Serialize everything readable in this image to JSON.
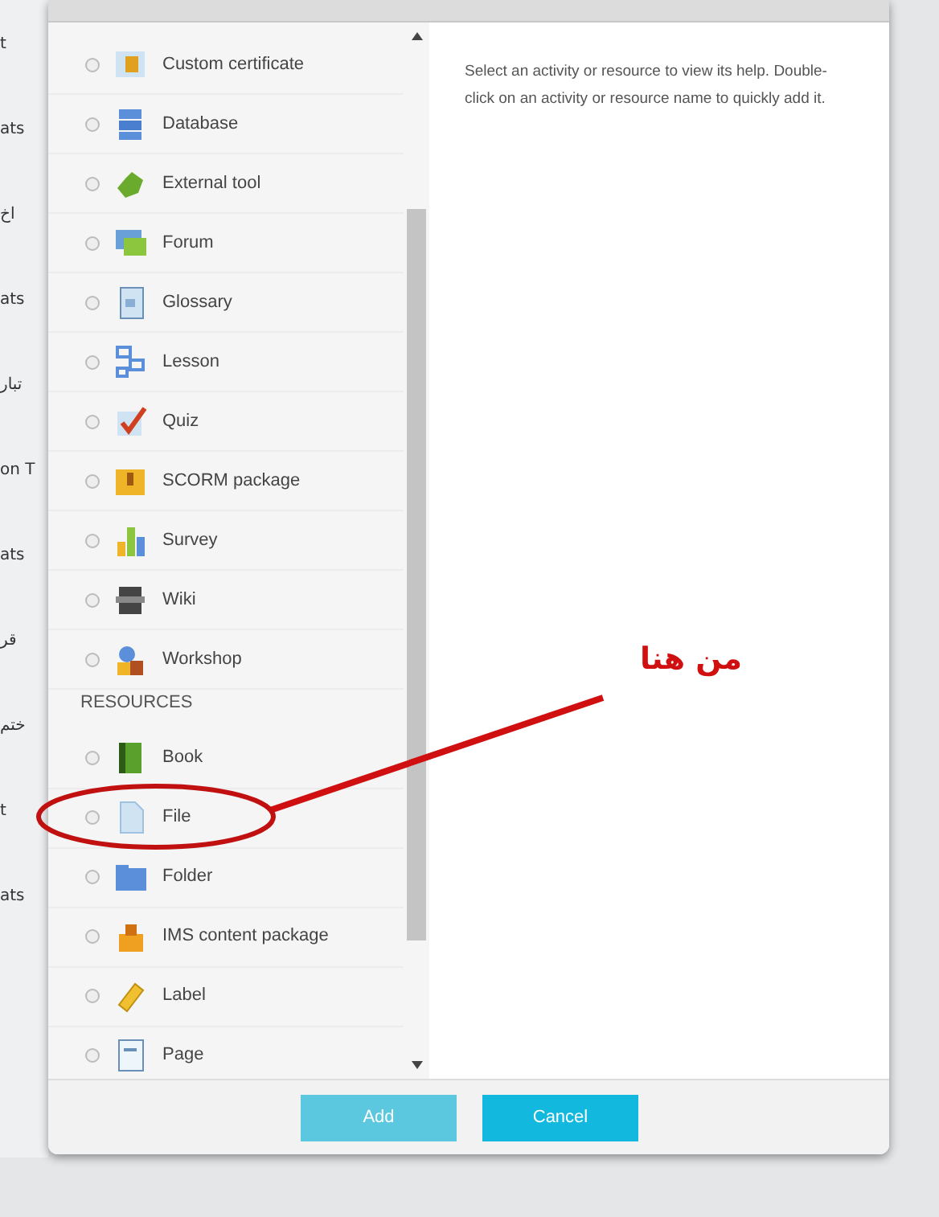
{
  "background_page": {
    "fragments": [
      "t",
      "ats",
      "اخ",
      "ats",
      "تبار",
      "on T",
      "ats",
      "قر",
      "ختم",
      "t",
      "ats"
    ]
  },
  "dialog": {
    "list": [
      {
        "kind": "item",
        "label": "Custom certificate",
        "selected": false
      },
      {
        "kind": "item",
        "label": "Database",
        "selected": false
      },
      {
        "kind": "item",
        "label": "External tool",
        "selected": false
      },
      {
        "kind": "item",
        "label": "Forum",
        "selected": false
      },
      {
        "kind": "item",
        "label": "Glossary",
        "selected": false
      },
      {
        "kind": "item",
        "label": "Lesson",
        "selected": false
      },
      {
        "kind": "item",
        "label": "Quiz",
        "selected": false
      },
      {
        "kind": "item",
        "label": "SCORM package",
        "selected": false
      },
      {
        "kind": "item",
        "label": "Survey",
        "selected": false
      },
      {
        "kind": "item",
        "label": "Wiki",
        "selected": false
      },
      {
        "kind": "item",
        "label": "Workshop",
        "selected": false
      },
      {
        "kind": "heading",
        "label": "RESOURCES"
      },
      {
        "kind": "item",
        "label": "Book",
        "selected": false
      },
      {
        "kind": "item",
        "label": "File",
        "selected": false
      },
      {
        "kind": "item",
        "label": "Folder",
        "selected": false
      },
      {
        "kind": "item",
        "label": "IMS content package",
        "selected": false
      },
      {
        "kind": "item",
        "label": "Label",
        "selected": false
      },
      {
        "kind": "item",
        "label": "Page",
        "selected": false
      }
    ],
    "help_text": "Select an activity or resource to view its help. Double-click on an activity or resource name to quickly add it.",
    "buttons": [
      {
        "label": "Add",
        "disabled": true
      },
      {
        "label": "Cancel",
        "disabled": false
      }
    ]
  },
  "annotation": {
    "text": "من هنا"
  }
}
